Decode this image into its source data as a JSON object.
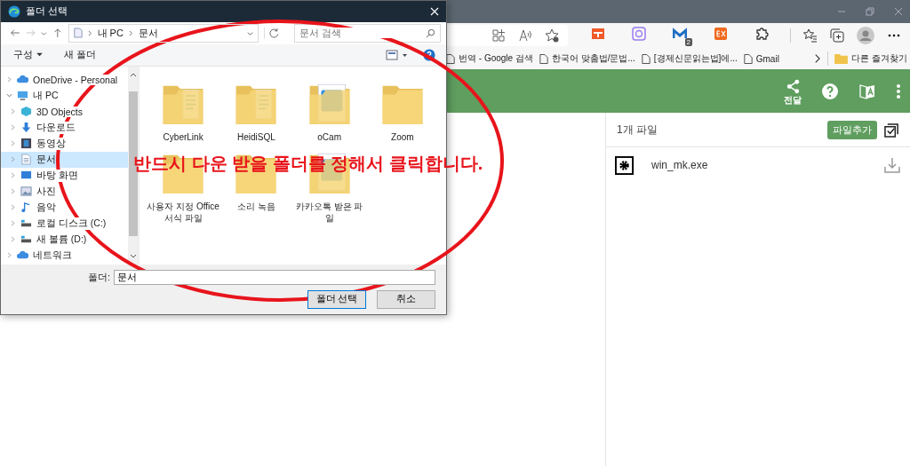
{
  "browser": {
    "extensions": [
      {
        "kind": "layout"
      },
      {
        "kind": "lens"
      },
      {
        "kind": "m",
        "badge": "2"
      },
      {
        "kind": "ex"
      },
      {
        "kind": "puzzle"
      }
    ],
    "bookmarks": [
      "번역 - Google 검색",
      "한국어 맞춤법/문법...",
      "[경제신문읽는법]에...",
      "Gmail"
    ],
    "other_bookmarks": "다른 즐겨찾기",
    "header": {
      "share_label": "전달"
    },
    "files_panel": {
      "count": "1개 파일",
      "add_button": "파일추가",
      "files": [
        {
          "name": "win_mk.exe"
        }
      ]
    }
  },
  "dialog": {
    "title": "폴더 선택",
    "breadcrumb": [
      "내 PC",
      "문서"
    ],
    "search": {
      "placeholder": "문서 검색"
    },
    "toolbar": {
      "organize": "구성",
      "new_folder": "새 폴더"
    },
    "nav": [
      {
        "label": "OneDrive - Personal",
        "kind": "cloud",
        "expanded": false,
        "selected": false
      },
      {
        "label": "내 PC",
        "kind": "pc",
        "expanded": true,
        "selected": false,
        "children": [
          {
            "label": "3D Objects",
            "kind": "cube",
            "selected": false
          },
          {
            "label": "다운로드",
            "kind": "download",
            "selected": false
          },
          {
            "label": "동영상",
            "kind": "video",
            "selected": false
          },
          {
            "label": "문서",
            "kind": "document",
            "selected": true
          },
          {
            "label": "바탕 화면",
            "kind": "desktop",
            "selected": false
          },
          {
            "label": "사진",
            "kind": "picture",
            "selected": false
          },
          {
            "label": "음악",
            "kind": "music",
            "selected": false
          },
          {
            "label": "로컬 디스크 (C:)",
            "kind": "drive",
            "selected": false
          },
          {
            "label": "새 볼륨 (D:)",
            "kind": "drive",
            "selected": false
          }
        ]
      },
      {
        "label": "네트워크",
        "kind": "network",
        "expanded": false,
        "selected": false
      }
    ],
    "folders": [
      {
        "name": "CyberLink",
        "kind": "files"
      },
      {
        "name": "HeidiSQL",
        "kind": "files"
      },
      {
        "name": "oCam",
        "kind": "app"
      },
      {
        "name": "Zoom",
        "kind": "plain"
      },
      {
        "name": "사용자 지정 Office 서식 파일",
        "kind": "plain"
      },
      {
        "name": "소리 녹음",
        "kind": "plain"
      },
      {
        "name": "카카오톡 받은 파일",
        "kind": "app"
      }
    ],
    "folder_field": {
      "label": "폴더:",
      "value": "문서"
    },
    "buttons": [
      {
        "label": "폴더 선택",
        "kind": "primary"
      },
      {
        "label": "취소",
        "kind": "secondary"
      }
    ]
  },
  "annotation": {
    "text": "반드시 다운 받을 폴더를 정해서 클릭합니다."
  }
}
